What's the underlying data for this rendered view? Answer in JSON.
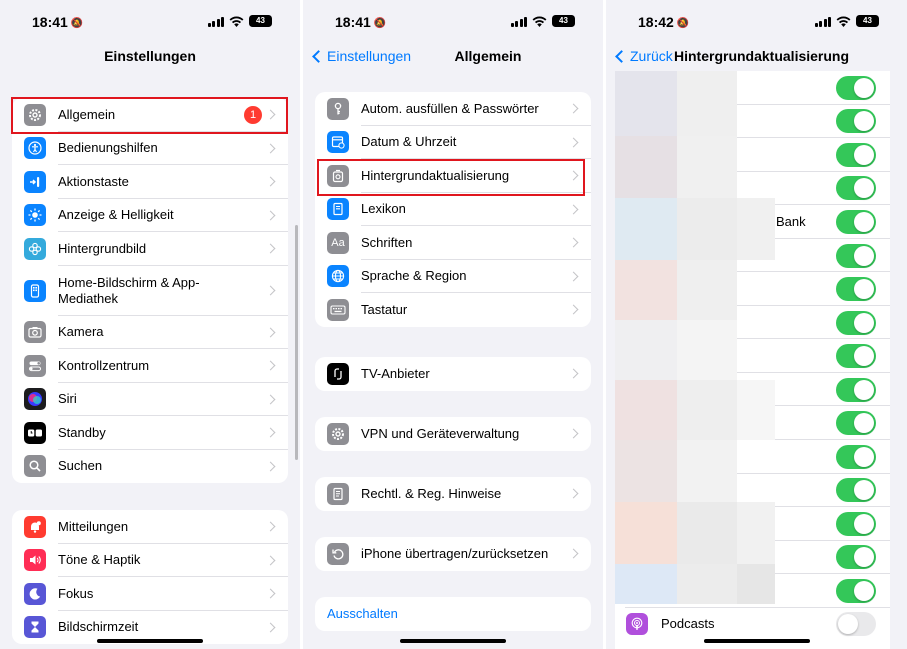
{
  "panels": [
    {
      "status": {
        "time": "18:41",
        "battery": "43"
      },
      "nav": {
        "title": "Einstellungen"
      },
      "group1": [
        {
          "label": "Allgemein",
          "badge": "1",
          "icon": "gear-icon",
          "color": "#8e8e93"
        },
        {
          "label": "Bedienungshilfen",
          "icon": "accessibility-icon",
          "color": "#0a84ff"
        },
        {
          "label": "Aktionstaste",
          "icon": "action-button-icon",
          "color": "#0a84ff"
        },
        {
          "label": "Anzeige & Helligkeit",
          "icon": "sun-icon",
          "color": "#0a84ff"
        },
        {
          "label": "Hintergrundbild",
          "icon": "wallpaper-flower-icon",
          "color": "#34aadc"
        },
        {
          "label": "Home-Bildschirm & App-Mediathek",
          "icon": "homescreen-icon",
          "color": "#0a84ff"
        },
        {
          "label": "Kamera",
          "icon": "camera-icon",
          "color": "#8e8e93"
        },
        {
          "label": "Kontrollzentrum",
          "icon": "switches-icon",
          "color": "#8e8e93"
        },
        {
          "label": "Siri",
          "icon": "siri-icon",
          "color": "#1c1c1e"
        },
        {
          "label": "Standby",
          "icon": "standby-icon",
          "color": "#000000"
        },
        {
          "label": "Suchen",
          "icon": "search-icon",
          "color": "#8e8e93"
        }
      ],
      "group2": [
        {
          "label": "Mitteilungen",
          "icon": "bell-icon",
          "color": "#ff3b30"
        },
        {
          "label": "Töne & Haptik",
          "icon": "speaker-icon",
          "color": "#ff2d55"
        },
        {
          "label": "Fokus",
          "icon": "moon-icon",
          "color": "#5856d6"
        },
        {
          "label": "Bildschirmzeit",
          "icon": "hourglass-icon",
          "color": "#5856d6"
        }
      ]
    },
    {
      "status": {
        "time": "18:41",
        "battery": "43"
      },
      "nav": {
        "back": "Einstellungen",
        "title": "Allgemein"
      },
      "group1": [
        {
          "label": "Autom. ausfüllen & Passwörter",
          "icon": "key-icon",
          "color": "#8e8e93"
        },
        {
          "label": "Datum & Uhrzeit",
          "icon": "calendar-clock-icon",
          "color": "#0a84ff"
        },
        {
          "label": "Hintergrundaktualisierung",
          "icon": "gear-refresh-icon",
          "color": "#8e8e93"
        },
        {
          "label": "Lexikon",
          "icon": "book-icon",
          "color": "#0a84ff"
        },
        {
          "label": "Schriften",
          "icon": "font-aa-icon",
          "color": "#8e8e93"
        },
        {
          "label": "Sprache & Region",
          "icon": "globe-icon",
          "color": "#0a84ff"
        },
        {
          "label": "Tastatur",
          "icon": "keyboard-icon",
          "color": "#8e8e93"
        }
      ],
      "group2": [
        {
          "label": "TV-Anbieter",
          "icon": "tv-provider-icon",
          "color": "#000000"
        }
      ],
      "group3": [
        {
          "label": "VPN und Geräteverwaltung",
          "icon": "gear-icon",
          "color": "#8e8e93"
        }
      ],
      "group4": [
        {
          "label": "Rechtl. & Reg. Hinweise",
          "icon": "document-icon",
          "color": "#8e8e93"
        }
      ],
      "group5": [
        {
          "label": "iPhone übertragen/zurücksetzen",
          "icon": "reset-icon",
          "color": "#8e8e93"
        }
      ],
      "group6": [
        {
          "label": "Ausschalten"
        }
      ]
    },
    {
      "status": {
        "time": "18:42",
        "battery": "43"
      },
      "nav": {
        "back": "Zurück",
        "title": "Hintergrundaktualisierung"
      },
      "partial_label": "Bank",
      "toggles_on": 16,
      "last": {
        "label": "Podcasts",
        "icon": "podcasts-icon",
        "color": "#b04fdc",
        "enabled": false
      }
    }
  ]
}
